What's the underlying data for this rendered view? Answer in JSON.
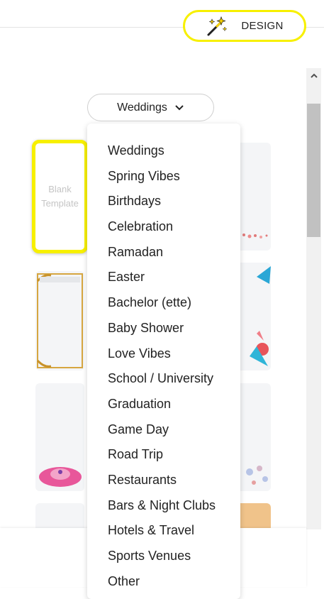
{
  "header": {
    "design_button": {
      "label": "DESIGN",
      "icon": "magic-wand-icon",
      "border_color": "#f7f000"
    }
  },
  "category_select": {
    "selected": "Weddings",
    "icon": "chevron-down-icon"
  },
  "blank_template": {
    "label": "Blank Template",
    "highlight_color": "#f7f000"
  },
  "dropdown": {
    "options": [
      "Weddings",
      "Spring Vibes",
      "Birthdays",
      "Celebration",
      "Ramadan",
      "Easter",
      "Bachelor (ette)",
      "Baby Shower",
      "Love Vibes",
      "School / University",
      "Graduation",
      "Game Day",
      "Road Trip",
      "Restaurants",
      "Bars & Night Clubs",
      "Hotels & Travel",
      "Sports Venues",
      "Other"
    ]
  }
}
